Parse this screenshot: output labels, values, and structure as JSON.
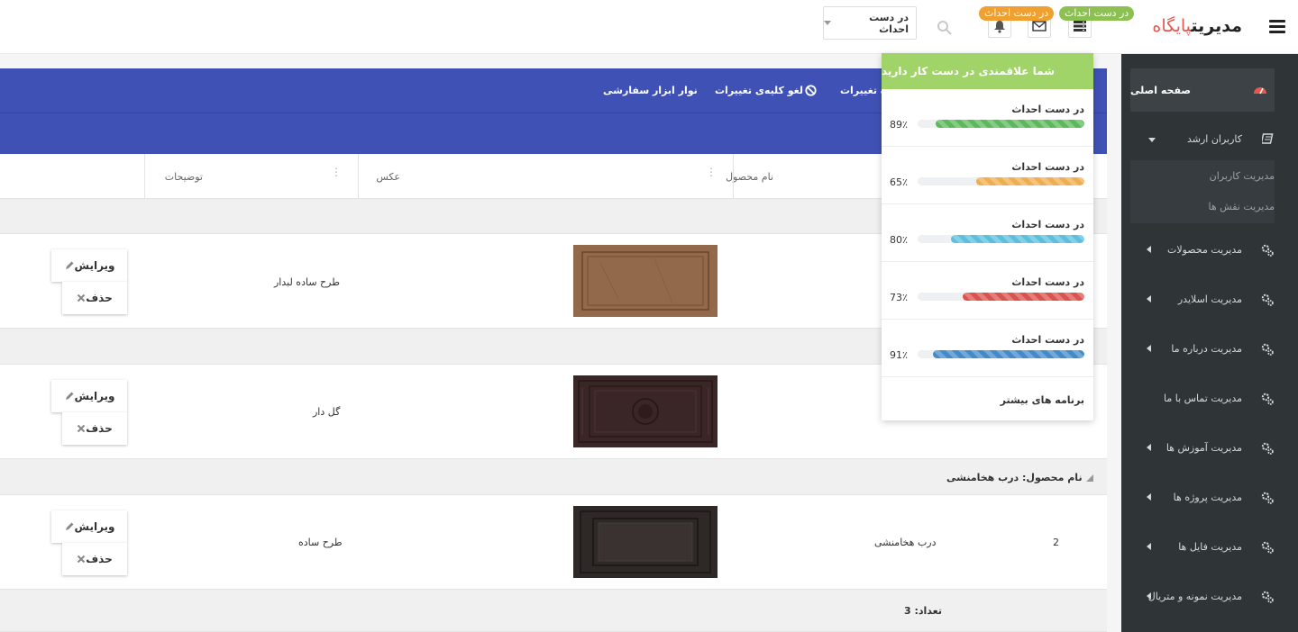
{
  "header": {
    "brand_main": "مدیریت",
    "brand_accent": "پایگاه",
    "badge_green": "در دست احداث",
    "badge_orange": "در دست احداث",
    "select_value": "در دست احداث",
    "icons": [
      "menu-icon",
      "server-icon",
      "mail-icon",
      "bell-icon",
      "search-icon"
    ]
  },
  "sidebar": {
    "home": "صفحه اصلی",
    "senior_users": "کاربران ارشد",
    "sub_items": [
      "مدیریت کاربران",
      "مدیریت نقش ها"
    ],
    "items": [
      "مدیریت محصولات",
      "مدیریت اسلایدر",
      "مدیریت درباره ما",
      "مدیریت تماس با ما",
      "مدیریت آموزش ها",
      "مدیریت پروژه ها",
      "مدیریت فایل ها",
      "مدیریت نمونه و متریال"
    ]
  },
  "toolbar": {
    "save_changes": "ذخیره تغییرات",
    "cancel_all": "لغو کلیه‌ی تغییرات",
    "custom_toolbar": "نوار ابزار سفارشی"
  },
  "grid": {
    "columns": {
      "product_name": "نام محصول",
      "photo": "عکس",
      "description": "توضیحات"
    },
    "group_label": "نام محصول: درب هخامنشی",
    "rows": [
      {
        "description": "طرح ساده لبدار",
        "product_name": "",
        "id": ""
      },
      {
        "description": "گل دار",
        "product_name": "",
        "id": ""
      },
      {
        "description": "طرح ساده",
        "product_name": "درب هخامنشی",
        "id": "2"
      }
    ],
    "edit_label": "ویرایش",
    "delete_label": "حذف",
    "footer_count": "تعداد: 3"
  },
  "tasks": {
    "title": "شما علاقمندی در دست کار دارید",
    "items": [
      {
        "name": "در دست احداث",
        "percent": "89٪",
        "value": 89,
        "color": "#5cb85c"
      },
      {
        "name": "در دست احداث",
        "percent": "65٪",
        "value": 65,
        "color": "#f0ad4e"
      },
      {
        "name": "در دست احداث",
        "percent": "80٪",
        "value": 80,
        "color": "#5bc0de"
      },
      {
        "name": "در دست احداث",
        "percent": "73٪",
        "value": 73,
        "color": "#d9534f"
      },
      {
        "name": "در دست احداث",
        "percent": "91٪",
        "value": 91,
        "color": "#428bca"
      }
    ],
    "more": "برنامه های بیشتر"
  },
  "colors": {
    "toolbar": "#3f51b5",
    "sidebar": "#2f3437",
    "brand_accent": "#e8574f",
    "dropdown_header": "#a0d468"
  }
}
